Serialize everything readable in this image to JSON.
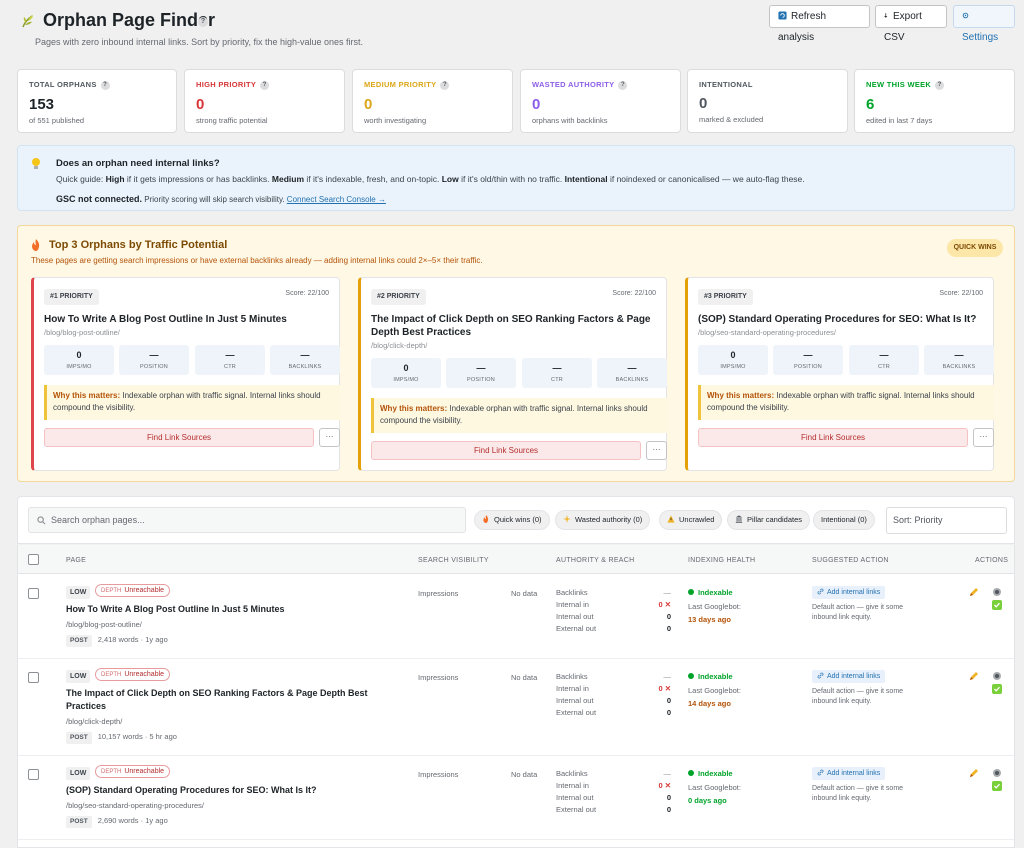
{
  "header": {
    "title": "Orphan Page Finder",
    "subtitle": "Pages with zero inbound internal links. Sort by priority, fix the high-value ones first.",
    "refresh_label": "Refresh analysis",
    "export_label": "Export CSV",
    "settings_label": "Settings"
  },
  "stats": [
    {
      "label": "TOTAL ORPHANS",
      "value": "153",
      "sub": "of 551 published",
      "color": "#1d2327"
    },
    {
      "label": "HIGH PRIORITY",
      "value": "0",
      "sub": "strong traffic potential",
      "color": "#d63638"
    },
    {
      "label": "MEDIUM PRIORITY",
      "value": "0",
      "sub": "worth investigating",
      "color": "#dba617"
    },
    {
      "label": "WASTED AUTHORITY",
      "value": "0",
      "sub": "orphans with backlinks",
      "color": "#8c5ee8"
    },
    {
      "label": "INTENTIONAL",
      "value": "0",
      "sub": "marked & excluded",
      "color": "#50575e"
    },
    {
      "label": "NEW THIS WEEK",
      "value": "6",
      "sub": "edited in last 7 days",
      "color": "#00a32a"
    }
  ],
  "info": {
    "title": "Does an orphan need internal links?",
    "guide_prefix": "Quick guide: ",
    "high": "High",
    "high_text": " if it gets impressions or has backlinks. ",
    "medium": "Medium",
    "medium_text": " if it's indexable, fresh, and on-topic. ",
    "low": "Low",
    "low_text": " if it's old/thin with no traffic. ",
    "intentional": "Intentional",
    "intentional_text": " if noindexed or canonicalised — we auto-flag these.",
    "gsc_status": "GSC not connected.",
    "gsc_text": " Priority scoring will skip search visibility. ",
    "gsc_link": "Connect Search Console →"
  },
  "top3": {
    "title": "Top 3 Orphans by Traffic Potential",
    "subtitle": "These pages are getting search impressions or have external backlinks already — adding internal links could 2×–5× their traffic.",
    "badge": "QUICK WINS",
    "why_label": "Why this matters:",
    "find_label": "Find Link Sources",
    "more_label": "···",
    "metric_labels": [
      "IMPS/MO",
      "POSITION",
      "CTR",
      "BACKLINKS"
    ],
    "cards": [
      {
        "rank": "#1 PRIORITY",
        "score": "Score: 22/100",
        "title": "How To Write A Blog Post Outline In Just 5 Minutes",
        "url": "/blog/blog-post-outline/",
        "metrics": [
          "0",
          "—",
          "—",
          "—"
        ],
        "why": " Indexable orphan with traffic signal. Internal links should compound the visibility."
      },
      {
        "rank": "#2 PRIORITY",
        "score": "Score: 22/100",
        "title": "The Impact of Click Depth on SEO Ranking Factors & Page Depth Best Practices",
        "url": "/blog/click-depth/",
        "metrics": [
          "0",
          "—",
          "—",
          "—"
        ],
        "why": " Indexable orphan with traffic signal. Internal links should compound the visibility."
      },
      {
        "rank": "#3 PRIORITY",
        "score": "Score: 22/100",
        "title": "(SOP) Standard Operating Procedures for SEO: What Is It?",
        "url": "/blog/seo-standard-operating-procedures/",
        "metrics": [
          "0",
          "—",
          "—",
          "—"
        ],
        "why": " Indexable orphan with traffic signal. Internal links should compound the visibility."
      }
    ]
  },
  "filters": {
    "search_placeholder": "Search orphan pages...",
    "chips": [
      "Quick wins (0)",
      "Wasted authority (0)",
      "Uncrawled",
      "Pillar candidates",
      "Intentional (0)"
    ],
    "sort_label": "Sort: Priority"
  },
  "table": {
    "headers": [
      "PAGE",
      "SEARCH VISIBILITY",
      "AUTHORITY & REACH",
      "INDEXING HEALTH",
      "SUGGESTED ACTION",
      "ACTIONS"
    ],
    "priority_label": "LOW",
    "depth_prefix": "DEPTH",
    "depth_value": "Unreachable",
    "type_label": "POST",
    "sv_label": "Impressions",
    "sv_value": "No data",
    "auth_labels": [
      "Backlinks",
      "Internal in",
      "Internal out",
      "External out"
    ],
    "index_status": "Indexable",
    "googlebot_label": "Last Googlebot:",
    "action_label": "Add internal links",
    "action_desc": "Default action — give it some inbound link equity.",
    "rows": [
      {
        "title": "How To Write A Blog Post Outline In Just 5 Minutes",
        "url": "/blog/blog-post-outline/",
        "words": "2,418 words",
        "ago": "1y ago",
        "backlinks": "—",
        "internal_in": "0",
        "internal_out": "0",
        "external_out": "0",
        "googlebot": "13 days ago"
      },
      {
        "title": "The Impact of Click Depth on SEO Ranking Factors & Page Depth Best Practices",
        "url": "/blog/click-depth/",
        "words": "10,157 words",
        "ago": "5 hr ago",
        "backlinks": "—",
        "internal_in": "0",
        "internal_out": "0",
        "external_out": "0",
        "googlebot": "14 days ago"
      },
      {
        "title": "(SOP) Standard Operating Procedures for SEO: What Is It?",
        "url": "/blog/seo-standard-operating-procedures/",
        "words": "2,690 words",
        "ago": "1y ago",
        "backlinks": "—",
        "internal_in": "0",
        "internal_out": "0",
        "external_out": "0",
        "googlebot": "0 days ago"
      }
    ]
  }
}
